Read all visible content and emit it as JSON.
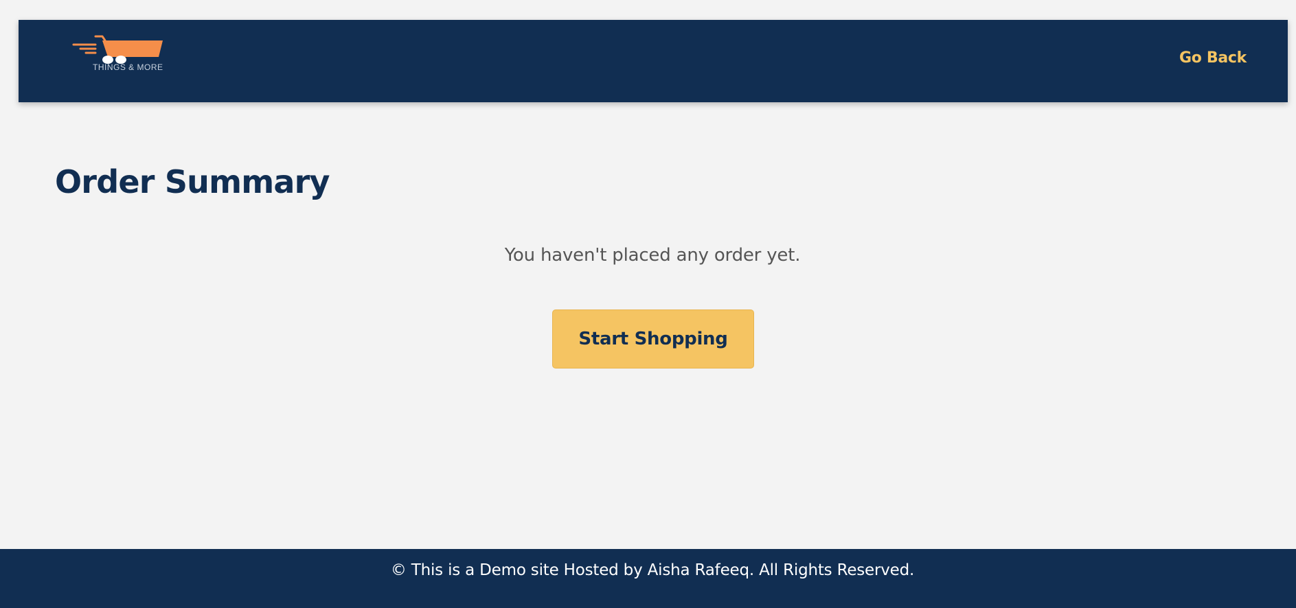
{
  "header": {
    "logo": {
      "icon": "shopping-cart-icon",
      "text": "THINGS & MORE",
      "colors": {
        "cart": "#f58e4a",
        "wheels": "#ffffff"
      }
    },
    "go_back_label": "Go Back"
  },
  "main": {
    "title": "Order Summary",
    "empty_message": "You haven't placed any order yet.",
    "start_shopping_label": "Start Shopping"
  },
  "footer": {
    "text": "© This is a Demo site Hosted by Aisha Rafeeq. All Rights Reserved."
  },
  "colors": {
    "navy": "#112e52",
    "accent": "#f5c462",
    "background": "#f3f3f3",
    "muted_text": "#555555"
  }
}
